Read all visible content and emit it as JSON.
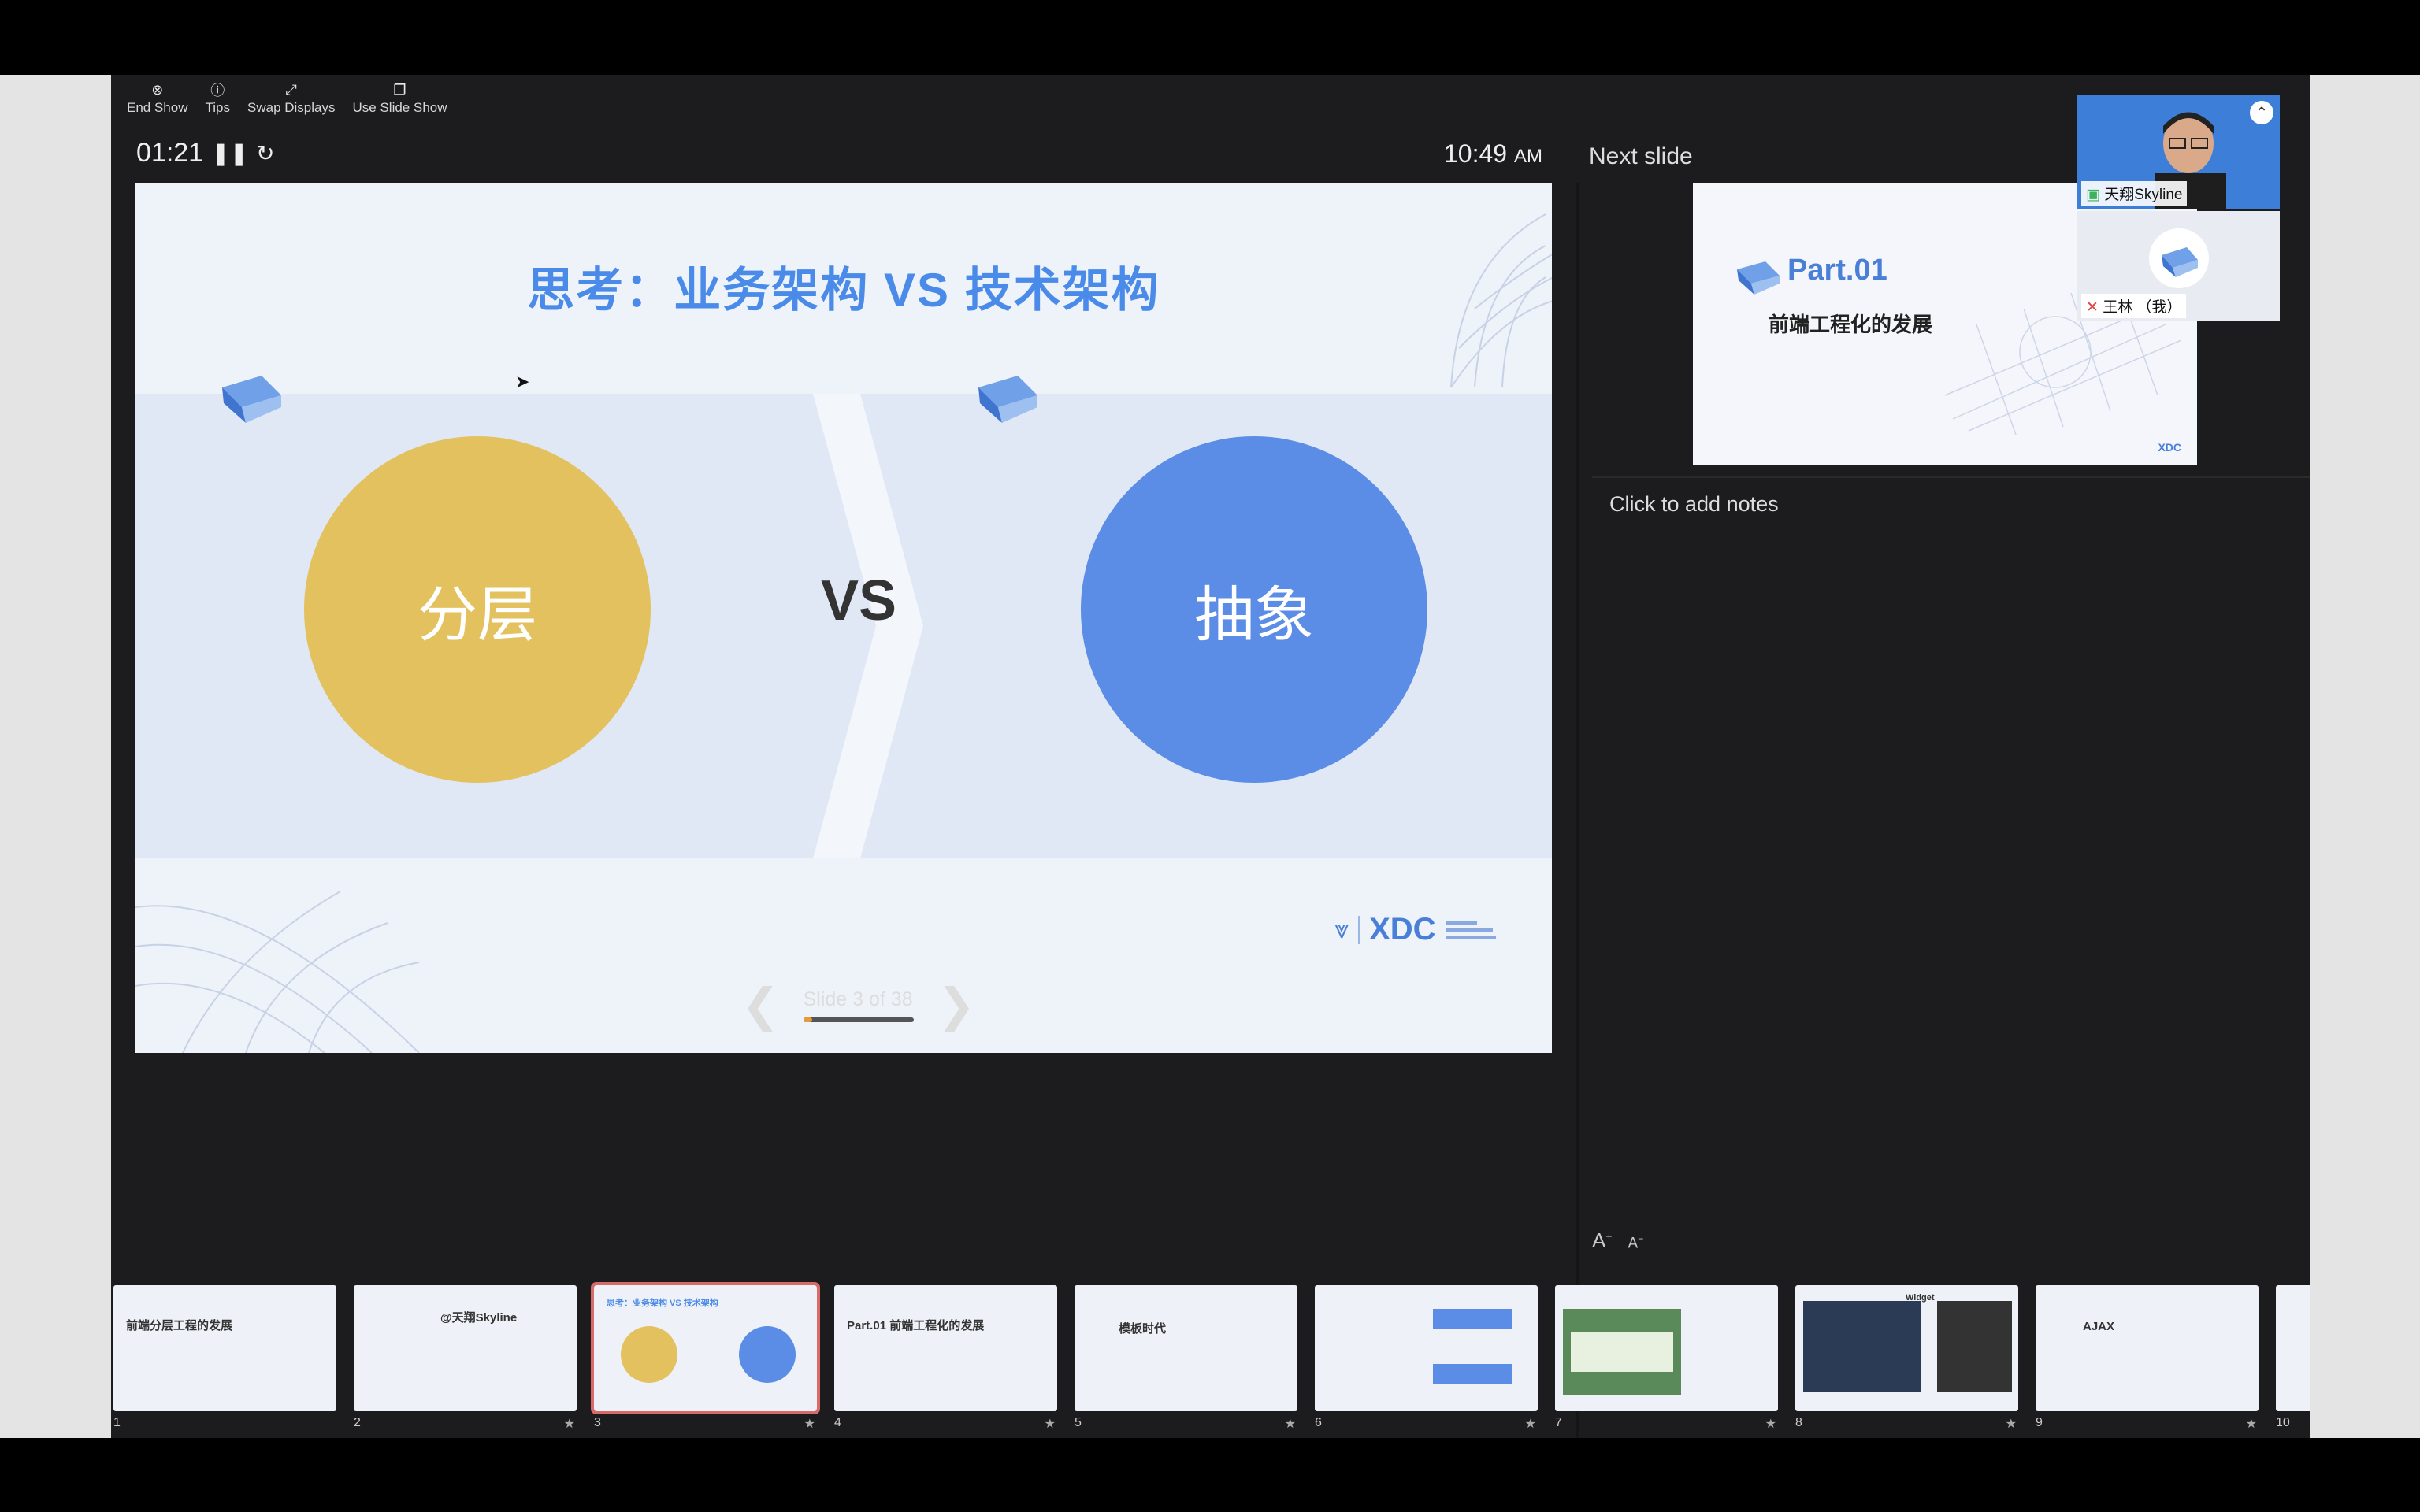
{
  "toolbar": {
    "items": [
      {
        "label": "End Show",
        "icon": "close-circle-icon"
      },
      {
        "label": "Tips",
        "icon": "info-icon"
      },
      {
        "label": "Swap Displays",
        "icon": "swap-icon"
      },
      {
        "label": "Use Slide Show",
        "icon": "window-icon"
      }
    ]
  },
  "timer": {
    "elapsed": "01:21"
  },
  "clock": {
    "time": "10:49",
    "ampm": "AM"
  },
  "current_slide": {
    "title": "思考：业务架构 VS 技术架构",
    "left_circle": "分层",
    "vs": "VS",
    "right_circle": "抽象",
    "logo_text": "XDC"
  },
  "navigation": {
    "slide_label": "Slide 3 of 38",
    "progress": 0.08
  },
  "next_slide": {
    "label": "Next slide",
    "part": "Part.01",
    "subtitle": "前端工程化的发展",
    "logo_text": "XDC"
  },
  "notes": {
    "placeholder": "Click to add notes"
  },
  "font_controls": {
    "increase": "A",
    "decrease": "A"
  },
  "participants": [
    {
      "name": "天翔Skyline"
    },
    {
      "name": "王林 （我）"
    }
  ],
  "thumbnails": [
    {
      "num": "1",
      "text": "前端分层工程的发展"
    },
    {
      "num": "2",
      "text": "@天翔Skyline"
    },
    {
      "num": "3",
      "text": "思考：业务架构 VS 技术架构"
    },
    {
      "num": "4",
      "text": "Part.01 前端工程化的发展"
    },
    {
      "num": "5",
      "text": "模板时代"
    },
    {
      "num": "6",
      "text": ""
    },
    {
      "num": "7",
      "text": ""
    },
    {
      "num": "8",
      "text": "Widget"
    },
    {
      "num": "9",
      "text": "AJAX"
    },
    {
      "num": "10",
      "text": ""
    }
  ],
  "colors": {
    "accent_yellow": "#e3c15e",
    "accent_blue": "#5b8de6",
    "title_blue": "#4a8ae8",
    "active_thumb": "#d96a6a"
  }
}
